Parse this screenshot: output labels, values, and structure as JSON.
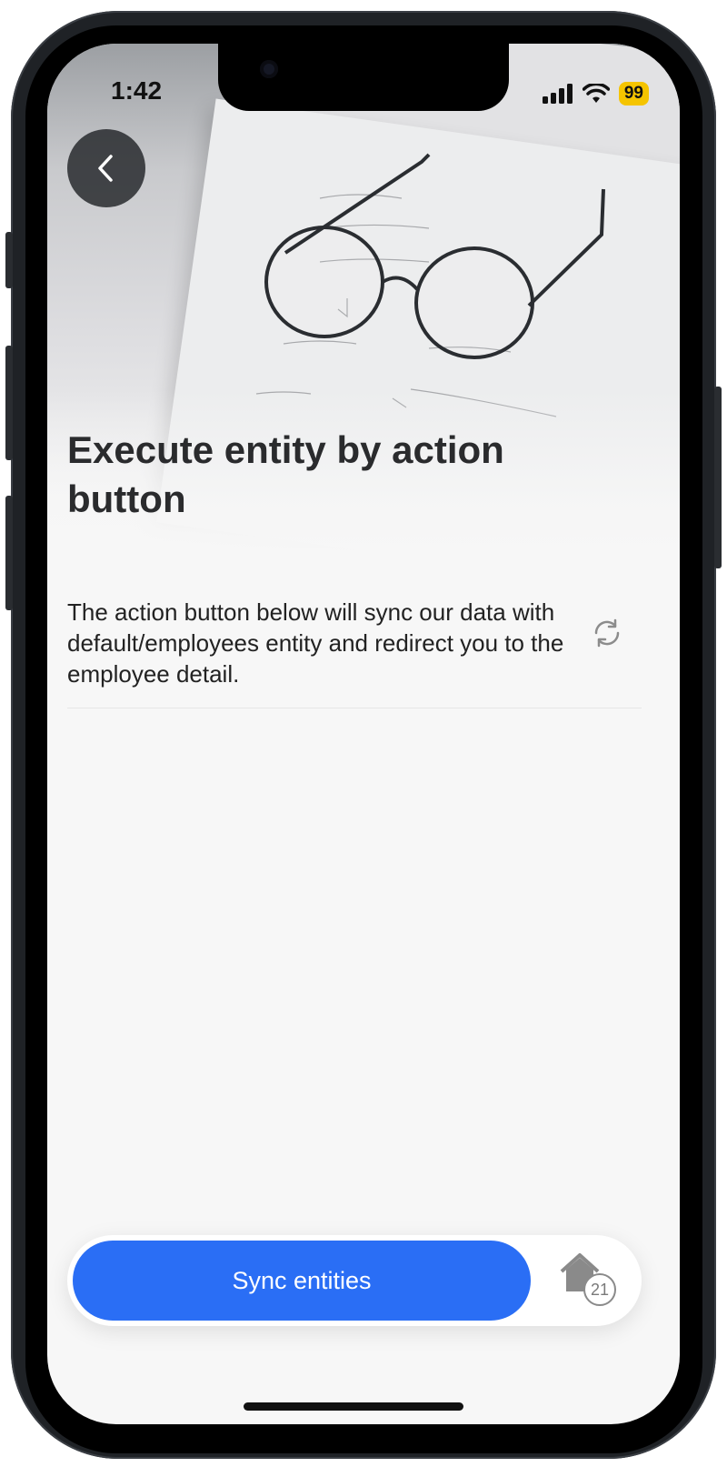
{
  "status_bar": {
    "time": "1:42",
    "battery": "99",
    "icons": [
      "signal-icon",
      "wifi-icon",
      "battery-icon"
    ]
  },
  "header": {
    "back_icon": "chevron-left-icon"
  },
  "main": {
    "title": "Execute entity by action button",
    "description": "The action button below will sync our data with default/employees entity and redirect you to the employee detail.",
    "description_icon": "sync-icon"
  },
  "bottom_bar": {
    "primary_button_label": "Sync entities",
    "home_icon": "home-icon",
    "home_badge": "21"
  },
  "colors": {
    "accent": "#2a6ef5",
    "battery": "#f5c400",
    "title_text": "#2a2b2d"
  }
}
